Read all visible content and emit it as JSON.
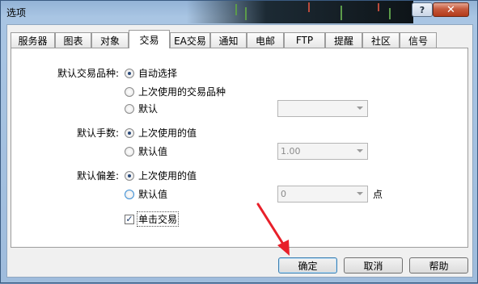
{
  "window": {
    "title": "选项",
    "help_label": "?",
    "close_label": "✕"
  },
  "tabs": [
    {
      "label": "服务器"
    },
    {
      "label": "图表"
    },
    {
      "label": "对象"
    },
    {
      "label": "交易",
      "active": true
    },
    {
      "label": "EA交易"
    },
    {
      "label": "通知"
    },
    {
      "label": "电邮"
    },
    {
      "label": "FTP"
    },
    {
      "label": "提醒"
    },
    {
      "label": "社区"
    },
    {
      "label": "信号"
    }
  ],
  "symbol": {
    "label": "默认交易品种:",
    "options": [
      "自动选择",
      "上次使用的交易品种",
      "默认"
    ],
    "selected": "自动选择",
    "combo_value": ""
  },
  "lots": {
    "label": "默认手数:",
    "options": [
      "上次使用的值",
      "默认值"
    ],
    "selected": "上次使用的值",
    "combo_value": "1.00"
  },
  "deviation": {
    "label": "默认偏差:",
    "options": [
      "上次使用的值",
      "默认值"
    ],
    "selected": "上次使用的值",
    "combo_value": "0",
    "unit": "点"
  },
  "one_click": {
    "label": "单击交易",
    "checked": true,
    "check_mark": "✓"
  },
  "buttons": {
    "ok": "确定",
    "cancel": "取消",
    "help": "帮助"
  },
  "colors": {
    "annotation_arrow": "#e8202a",
    "title_bar": "#9fbcdc"
  }
}
